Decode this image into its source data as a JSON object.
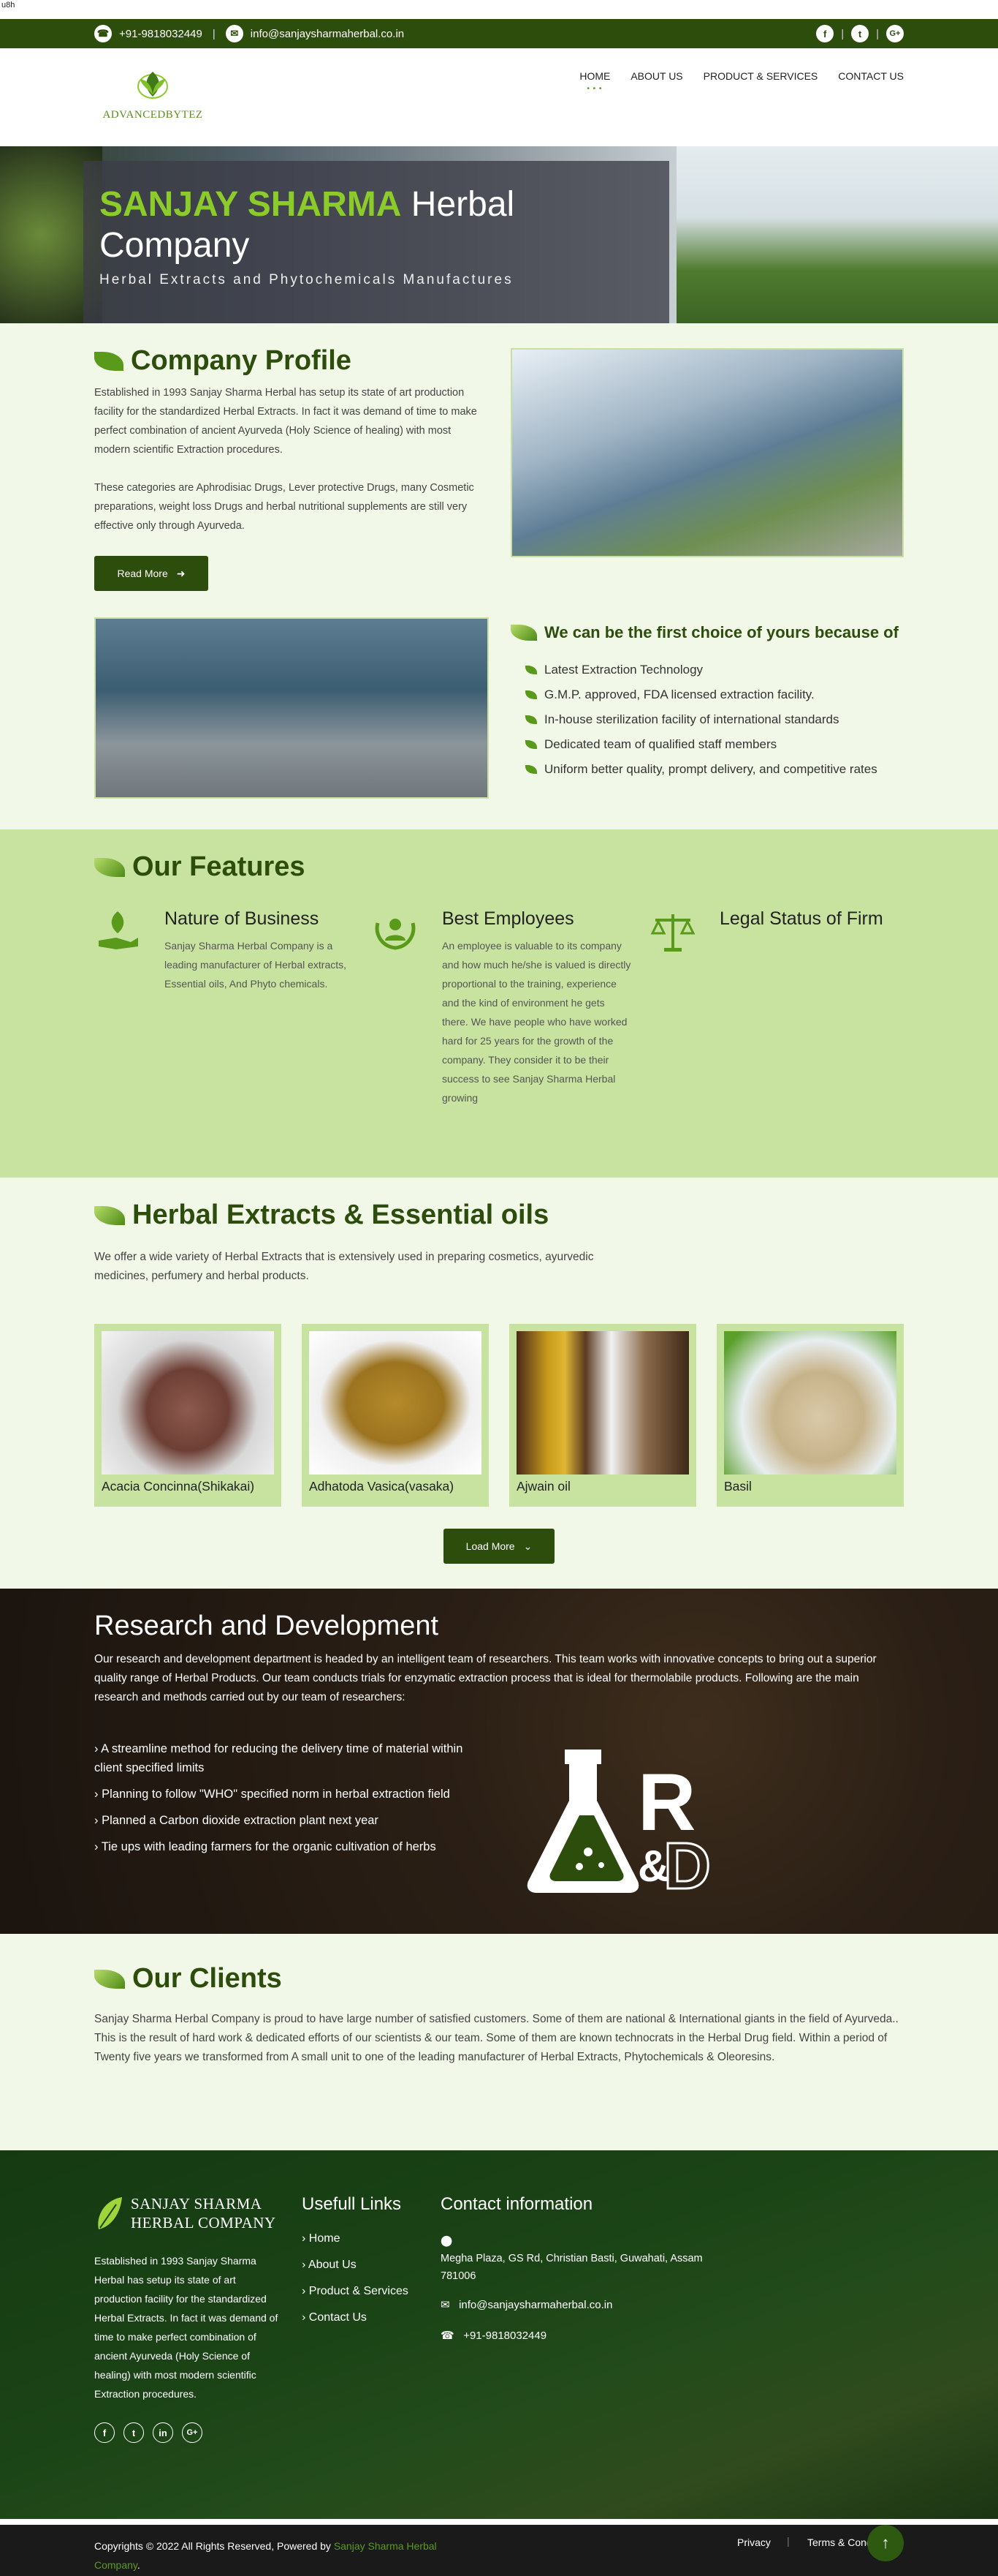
{
  "browser_status": "u8h",
  "topbar": {
    "phone": "+91-9818032449",
    "email": "info@sanjaysharmaherbal.co.in"
  },
  "logo_text": "ADVANCEDBYTEZ",
  "nav": [
    {
      "label": "HOME"
    },
    {
      "label": "ABOUT US"
    },
    {
      "label": "PRODUCT & SERVICES"
    },
    {
      "label": "CONTACT US"
    }
  ],
  "hero": {
    "title_green": "SANJAY SHARMA",
    "title_white": "Herbal",
    "title_line2": "Company",
    "subtitle": "Herbal Extracts and Phytochemicals Manufactures"
  },
  "profile": {
    "title": "Company Profile",
    "para1": "Established in 1993 Sanjay Sharma Herbal has setup its state of art production facility for the standardized Herbal Extracts. In fact it was demand of time to make perfect combination of ancient Ayurveda (Holy Science of healing) with most modern scientific Extraction procedures.",
    "para2": "These categories are Aphrodisiac Drugs, Lever protective Drugs, many Cosmetic preparations, weight loss Drugs and herbal nutritional supplements are still very effective only through Ayurveda.",
    "read_more": "Read More"
  },
  "choice": {
    "title": "We can be the first choice of yours because of",
    "items": [
      "Latest Extraction Technology",
      "G.M.P. approved, FDA licensed extraction facility.",
      "In-house sterilization facility of international standards",
      "Dedicated team of qualified staff members",
      "Uniform better quality, prompt delivery, and competitive rates"
    ]
  },
  "features": {
    "title": "Our Features",
    "items": [
      {
        "title": "Nature of Business",
        "text": "Sanjay Sharma Herbal Company is a leading manufacturer of Herbal extracts, Essential oils, And Phyto chemicals."
      },
      {
        "title": "Best Employees",
        "text": "An employee is valuable to its company and how much he/she is valued is directly proportional to the training, experience and the kind of environment he gets there. We have people who have worked hard for 25 years for the growth of the company. They consider it to be their success to see Sanjay Sharma Herbal growing"
      },
      {
        "title": "Legal Status of Firm",
        "text": ""
      }
    ]
  },
  "products": {
    "title": "Herbal Extracts & Essential oils",
    "intro": "We offer a wide variety of Herbal Extracts that is extensively used in preparing cosmetics, ayurvedic medicines, perfumery and herbal products.",
    "items": [
      {
        "label": "Acacia Concinna(Shikakai)"
      },
      {
        "label": "Adhatoda Vasica(vasaka)"
      },
      {
        "label": "Ajwain oil"
      },
      {
        "label": "Basil"
      }
    ],
    "load_more": "Load More"
  },
  "research": {
    "title": "Research and Development",
    "text": "Our research and development department is headed by an intelligent team of researchers. This team works with innovative concepts to bring out a superior quality range of Herbal Products. Our team conducts trials for enzymatic extraction process that is ideal for thermolabile products. Following are the main research and methods carried out by our team of researchers:",
    "items": [
      "A streamline method for reducing the delivery time of material within client specified limits",
      "Planning to follow \"WHO\" specified norm in herbal extraction field",
      "Planned a Carbon dioxide extraction plant next year",
      "Tie ups with leading farmers for the organic cultivation of herbs"
    ],
    "logo_r": "R",
    "logo_amp": "&",
    "logo_d": "D"
  },
  "clients": {
    "title": "Our Clients",
    "text": "Sanjay Sharma Herbal Company is proud to have large number of satisfied customers. Some of them are national & International giants in the field of Ayurveda.. This is the result of hard work & dedicated efforts of our scientists & our team. Some of them are known technocrats in the Herbal Drug field. Within a period of Twenty five years we transformed from A small unit to one of the leading manufacturer of Herbal Extracts, Phytochemicals & Oleoresins."
  },
  "footer": {
    "brand_line1": "SANJAY SHARMA",
    "brand_line2": "HERBAL COMPANY",
    "about": "Established in 1993 Sanjay Sharma Herbal has setup its state of art production facility for the standardized Herbal Extracts. In fact it was demand of time to make perfect combination of ancient Ayurveda (Holy Science of healing) with most modern scientific Extraction procedures.",
    "links_title": "Usefull Links",
    "links": [
      "Home",
      "About Us",
      "Product & Services",
      "Contact Us"
    ],
    "contact_title": "Contact information",
    "address": "Megha Plaza, GS Rd, Christian Basti, Guwahati, Assam 781006",
    "email": "info@sanjaysharmaherbal.co.in",
    "phone": "+91-9818032449"
  },
  "copyright": {
    "prefix": "Copyrights © 2022 All Rights Reserved, Powered by",
    "link": "Sanjay Sharma Herbal",
    "link2": "Company",
    "suffix": ".",
    "privacy": "Privacy",
    "terms": "Terms & Conditions"
  },
  "colors": {
    "primary": "#2d4d0d",
    "accent": "#5a9a1a",
    "light_bg": "#f2f8e8",
    "feature_bg": "#c8e3a0"
  }
}
